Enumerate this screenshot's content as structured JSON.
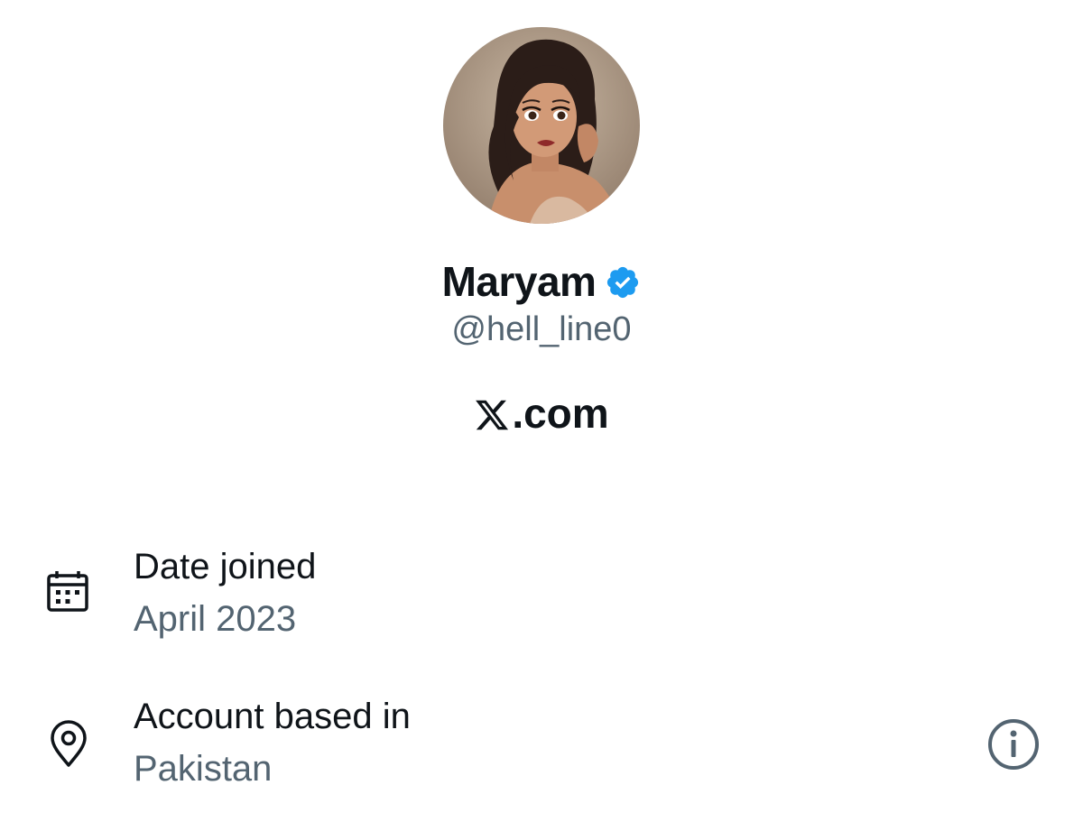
{
  "profile": {
    "display_name": "Maryam",
    "handle": "@hell_line0",
    "verified_icon": "verified-badge-icon",
    "avatar_description_icon": "avatar-image"
  },
  "site": {
    "logo_icon": "x-logo-icon",
    "suffix": ".com"
  },
  "details": {
    "date_joined": {
      "icon": "calendar-icon",
      "label": "Date joined",
      "value": "April 2023"
    },
    "account_based_in": {
      "icon": "location-pin-icon",
      "label": "Account based in",
      "value": "Pakistan",
      "info_icon": "info-icon"
    }
  },
  "colors": {
    "primary_text": "#0f1419",
    "secondary_text": "#536471",
    "verified_blue": "#1d9bf0",
    "background": "#ffffff"
  }
}
